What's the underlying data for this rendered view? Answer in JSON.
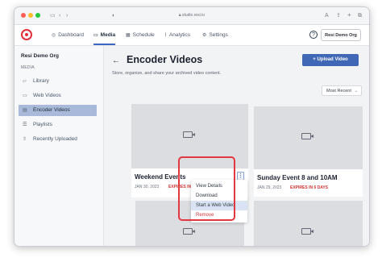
{
  "browser": {
    "url": "studio.resi.io"
  },
  "nav": {
    "items": [
      {
        "label": "Dashboard",
        "icon": "dashboard-icon"
      },
      {
        "label": "Media",
        "icon": "folder-icon"
      },
      {
        "label": "Schedule",
        "icon": "calendar-icon"
      },
      {
        "label": "Analytics",
        "icon": "analytics-icon"
      },
      {
        "label": "Settings",
        "icon": "gear-icon"
      }
    ],
    "active": "Media",
    "help_icon": "?",
    "org_button": "Resi Demo Org"
  },
  "sidebar": {
    "org_name": "Resi Demo Org",
    "section": "MEDIA",
    "items": [
      {
        "label": "Library",
        "icon": "library-icon"
      },
      {
        "label": "Web Videos",
        "icon": "monitor-icon"
      },
      {
        "label": "Encoder Videos",
        "icon": "encoder-icon"
      },
      {
        "label": "Playlists",
        "icon": "playlist-icon"
      },
      {
        "label": "Recently Uploaded",
        "icon": "upload-icon"
      }
    ],
    "active": "Encoder Videos"
  },
  "main": {
    "title": "Encoder Videos",
    "subtitle": "Store, organize, and share your archived video content.",
    "upload_button": "+ Upload Video",
    "sort": "Most Recent",
    "videos": [
      {
        "title": "Weekend Events",
        "date": "JAN 30, 2023",
        "expires": "EXPIRES IN"
      },
      {
        "title": "Sunday Event 8 and 10AM",
        "date": "JAN 29, 2023",
        "expires": "EXPIRES IN 6 DAYS"
      },
      {
        "title": "",
        "date": "",
        "expires": ""
      },
      {
        "title": "",
        "date": "",
        "expires": ""
      }
    ],
    "kebab": "⋮",
    "context_menu": [
      "View Details",
      "Download",
      "Start a Web Video",
      "Remove"
    ]
  },
  "colors": {
    "accent": "#3f67b5",
    "danger": "#d33434",
    "highlight_box": "#e2383f"
  }
}
